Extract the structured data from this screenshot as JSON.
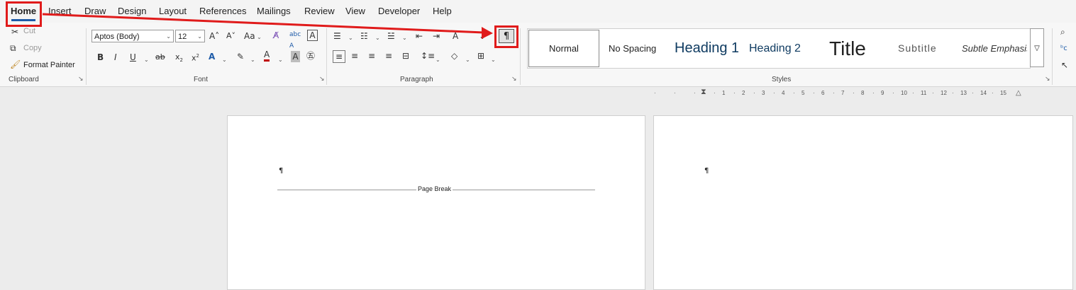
{
  "menu": {
    "tabs": [
      "Home",
      "Insert",
      "Draw",
      "Design",
      "Layout",
      "References",
      "Mailings",
      "Review",
      "View",
      "Developer",
      "Help"
    ],
    "active_tab": "Home"
  },
  "clipboard": {
    "cut": "Cut",
    "copy": "Copy",
    "format_painter": "Format Painter",
    "label": "Clipboard"
  },
  "font": {
    "family": "Aptos (Body)",
    "size": "12",
    "case_label": "Aa",
    "label": "Font"
  },
  "paragraph": {
    "label": "Paragraph",
    "show_marks_glyph": "¶"
  },
  "styles": {
    "label": "Styles",
    "items": [
      "Normal",
      "No Spacing",
      "Heading 1",
      "Heading 2",
      "Title",
      "Subtitle",
      "Subtle Emphasis"
    ]
  },
  "ruler": {
    "ticks": [
      "1",
      "2",
      "3",
      "4",
      "5",
      "6",
      "7",
      "8",
      "9",
      "10",
      "11",
      "12",
      "13",
      "14",
      "15"
    ]
  },
  "document": {
    "page1_mark": "¶",
    "page_break_label": "Page Break",
    "page2_mark": "¶"
  },
  "colors": {
    "accent": "#1e5ba8",
    "annotation": "#e01b1b",
    "font_color_bar": "#c00000"
  }
}
